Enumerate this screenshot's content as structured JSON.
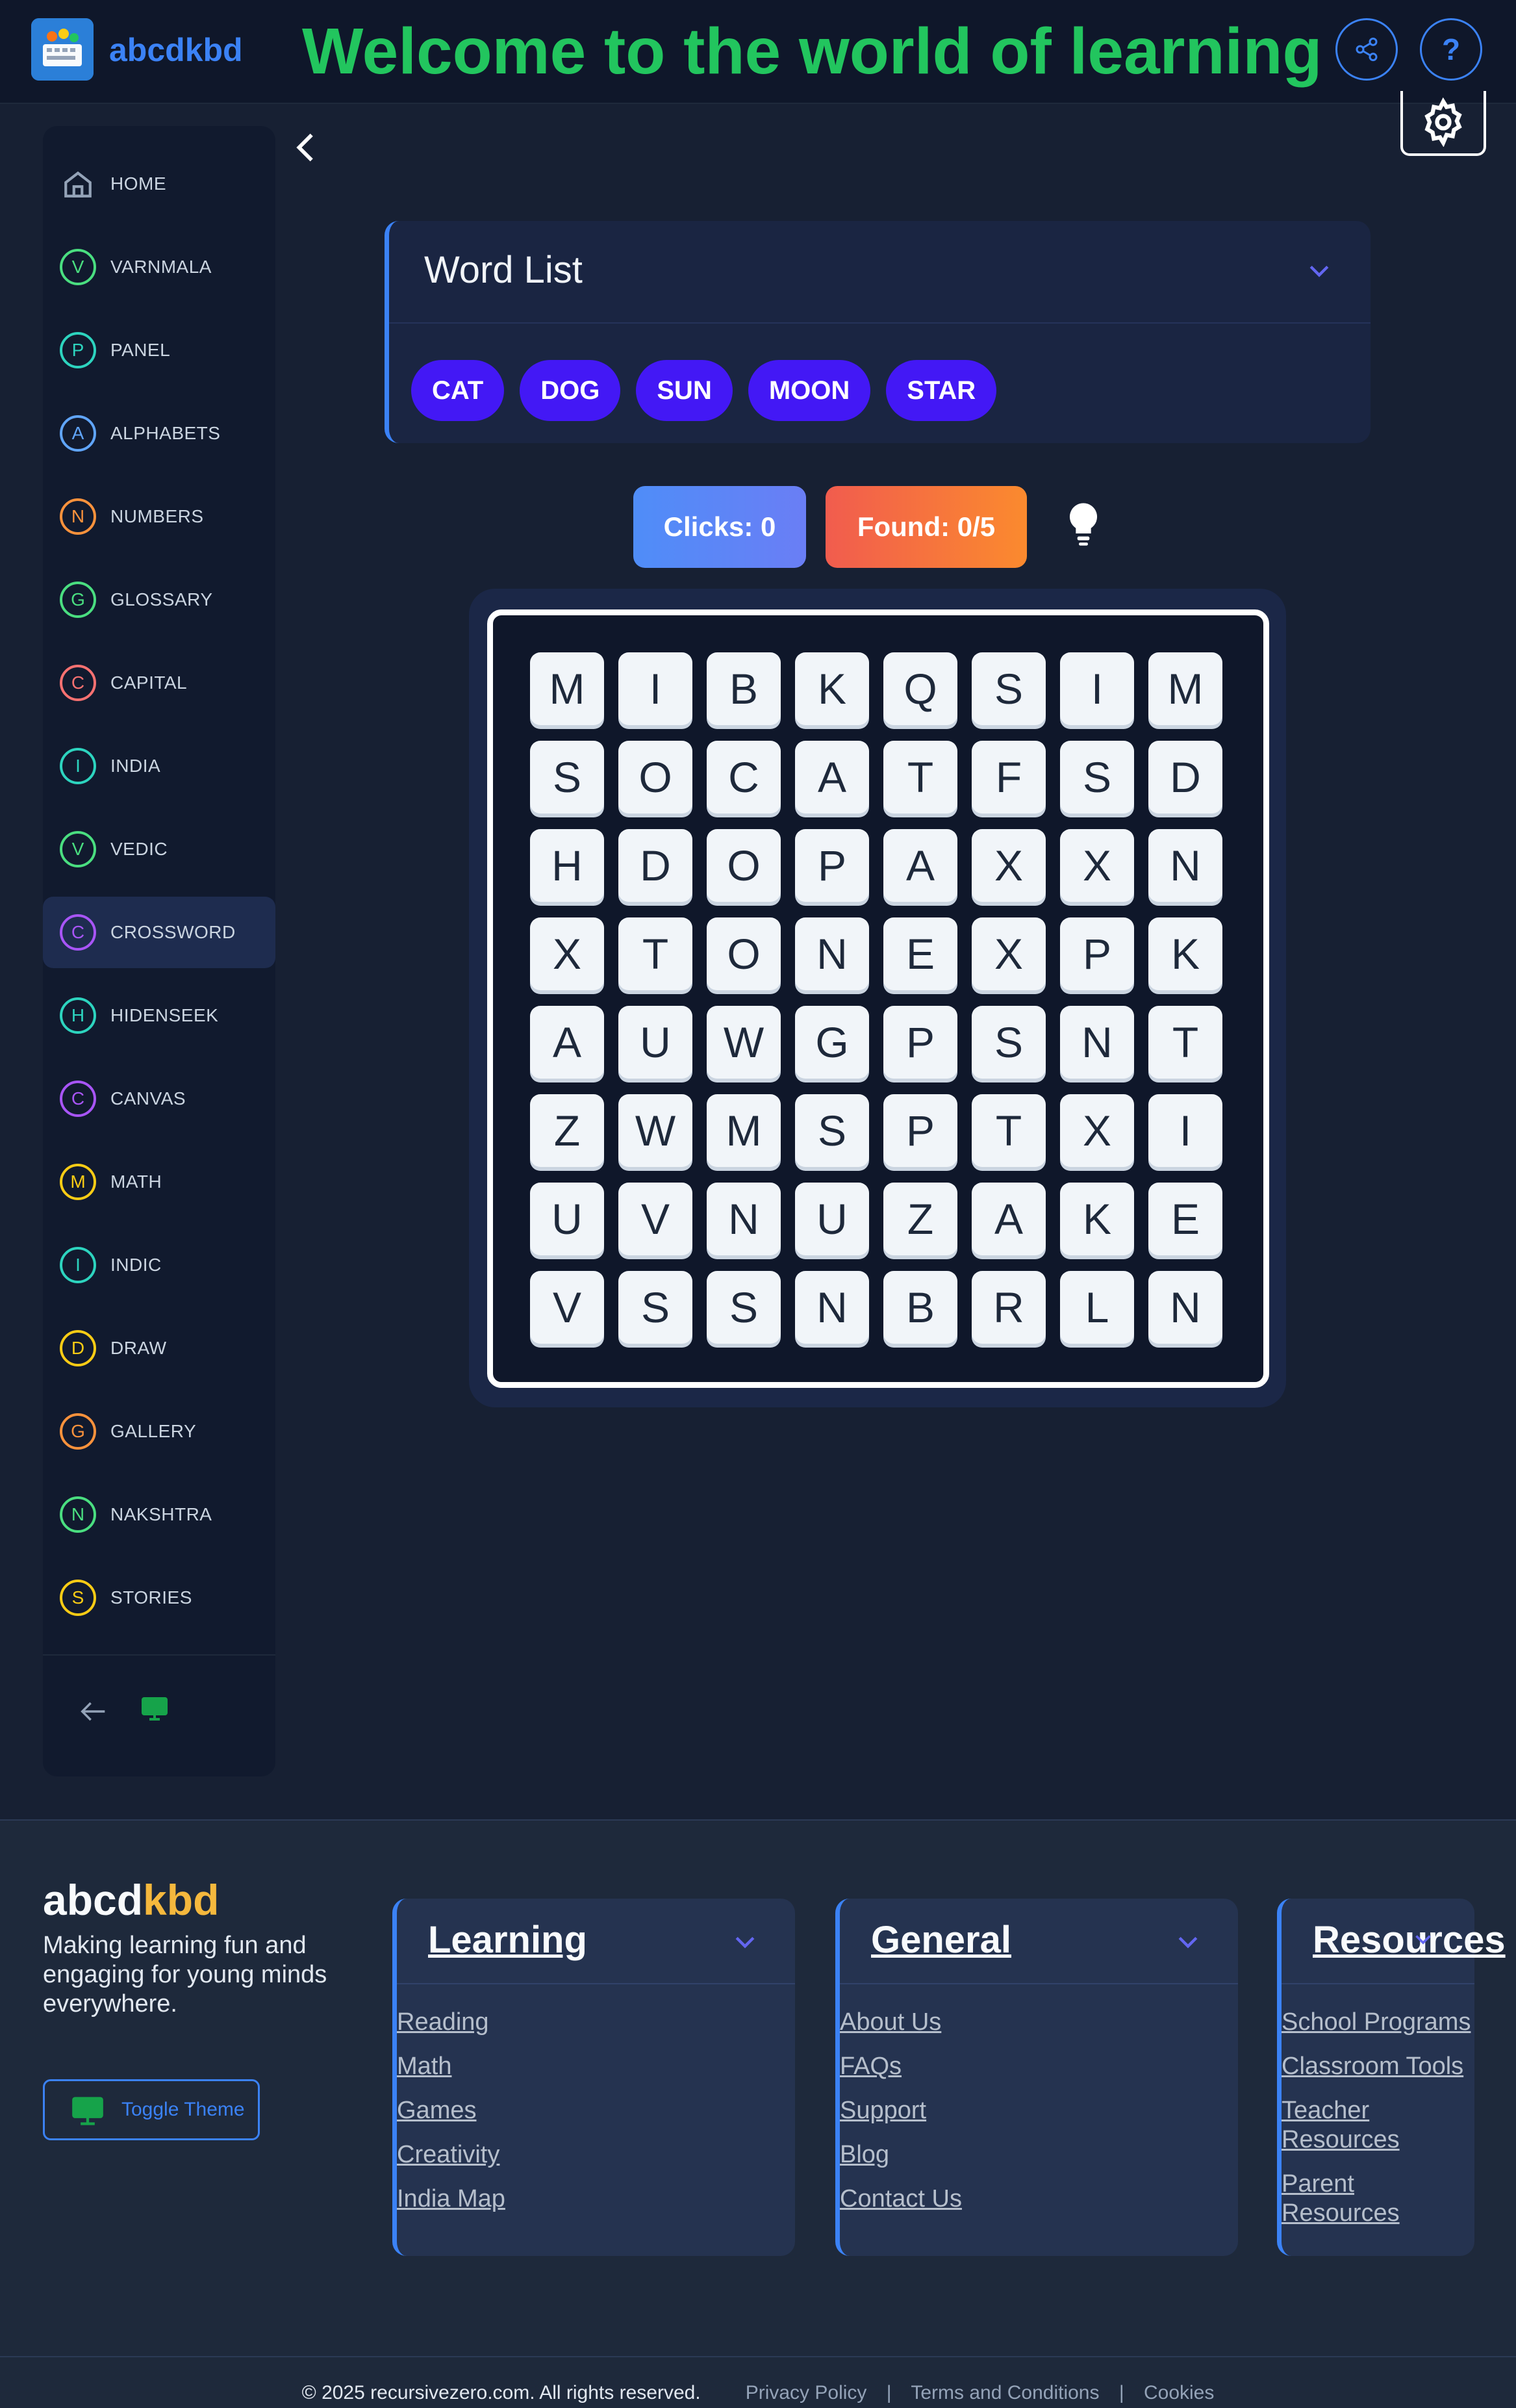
{
  "header": {
    "brand": "abcdkbd",
    "welcome": "Welcome to the world of learning",
    "help_label": "?"
  },
  "sidebar": {
    "items": [
      {
        "icon": "home-icon",
        "letter": "",
        "label": "HOME",
        "color": "#94a3b8"
      },
      {
        "icon": "letter-v-icon",
        "letter": "V",
        "label": "VARNMALA",
        "color": "#4ade80"
      },
      {
        "icon": "letter-p-icon",
        "letter": "P",
        "label": "PANEL",
        "color": "#2dd4bf"
      },
      {
        "icon": "letter-a-icon",
        "letter": "A",
        "label": "ALPHABETS",
        "color": "#60a5fa"
      },
      {
        "icon": "letter-n-icon",
        "letter": "N",
        "label": "NUMBERS",
        "color": "#fb923c"
      },
      {
        "icon": "letter-g-icon",
        "letter": "G",
        "label": "GLOSSARY",
        "color": "#4ade80"
      },
      {
        "icon": "letter-c-icon",
        "letter": "C",
        "label": "CAPITAL",
        "color": "#f87171"
      },
      {
        "icon": "letter-i-icon",
        "letter": "I",
        "label": "INDIA",
        "color": "#2dd4bf"
      },
      {
        "icon": "letter-v-icon",
        "letter": "V",
        "label": "VEDIC",
        "color": "#4ade80"
      },
      {
        "icon": "letter-c-icon",
        "letter": "C",
        "label": "CROSSWORD",
        "color": "#a855f7",
        "active": true
      },
      {
        "icon": "letter-h-icon",
        "letter": "H",
        "label": "HIDENSEEK",
        "color": "#2dd4bf"
      },
      {
        "icon": "letter-c-icon",
        "letter": "C",
        "label": "CANVAS",
        "color": "#a855f7"
      },
      {
        "icon": "letter-m-icon",
        "letter": "M",
        "label": "MATH",
        "color": "#facc15"
      },
      {
        "icon": "letter-i-icon",
        "letter": "I",
        "label": "INDIC",
        "color": "#2dd4bf"
      },
      {
        "icon": "letter-d-icon",
        "letter": "D",
        "label": "DRAW",
        "color": "#facc15"
      },
      {
        "icon": "letter-g-icon",
        "letter": "G",
        "label": "GALLERY",
        "color": "#fb923c"
      },
      {
        "icon": "letter-n-icon",
        "letter": "N",
        "label": "NAKSHTRA",
        "color": "#4ade80"
      },
      {
        "icon": "letter-s-icon",
        "letter": "S",
        "label": "STORIES",
        "color": "#facc15"
      }
    ]
  },
  "word_list": {
    "title": "Word List",
    "words": [
      "CAT",
      "DOG",
      "SUN",
      "MOON",
      "STAR"
    ]
  },
  "stats": {
    "clicks": "Clicks: 0",
    "found": "Found: 0/5"
  },
  "grid": [
    [
      "M",
      "I",
      "B",
      "K",
      "Q",
      "S",
      "I",
      "M"
    ],
    [
      "S",
      "O",
      "C",
      "A",
      "T",
      "F",
      "S",
      "D"
    ],
    [
      "H",
      "D",
      "O",
      "P",
      "A",
      "X",
      "X",
      "N"
    ],
    [
      "X",
      "T",
      "O",
      "N",
      "E",
      "X",
      "P",
      "K"
    ],
    [
      "A",
      "U",
      "W",
      "G",
      "P",
      "S",
      "N",
      "T"
    ],
    [
      "Z",
      "W",
      "M",
      "S",
      "P",
      "T",
      "X",
      "I"
    ],
    [
      "U",
      "V",
      "N",
      "U",
      "Z",
      "A",
      "K",
      "E"
    ],
    [
      "V",
      "S",
      "S",
      "N",
      "B",
      "R",
      "L",
      "N"
    ]
  ],
  "footer": {
    "brand_a": "abcd",
    "brand_b": "kbd",
    "tagline": "Making learning fun and engaging for young minds everywhere.",
    "toggle_theme": "Toggle Theme",
    "columns": [
      {
        "title": "Learning",
        "links": [
          "Reading",
          "Math",
          "Games",
          "Creativity",
          "India Map"
        ]
      },
      {
        "title": "General",
        "links": [
          "About Us",
          "FAQs",
          "Support",
          "Blog",
          "Contact Us"
        ]
      },
      {
        "title": "Resources",
        "links": [
          "School Programs",
          "Classroom Tools",
          "Teacher Resources",
          "Parent Resources"
        ]
      }
    ],
    "copyright": "© 2025 recursivezero.com. All rights reserved.",
    "legal_links": [
      "Privacy Policy",
      "Terms and Conditions",
      "Cookies"
    ]
  },
  "colors": {
    "accent_blue": "#3b82f6",
    "headline_green": "#22c55e",
    "chip_purple": "#4318f5",
    "brand_yellow": "#f5b83d"
  }
}
